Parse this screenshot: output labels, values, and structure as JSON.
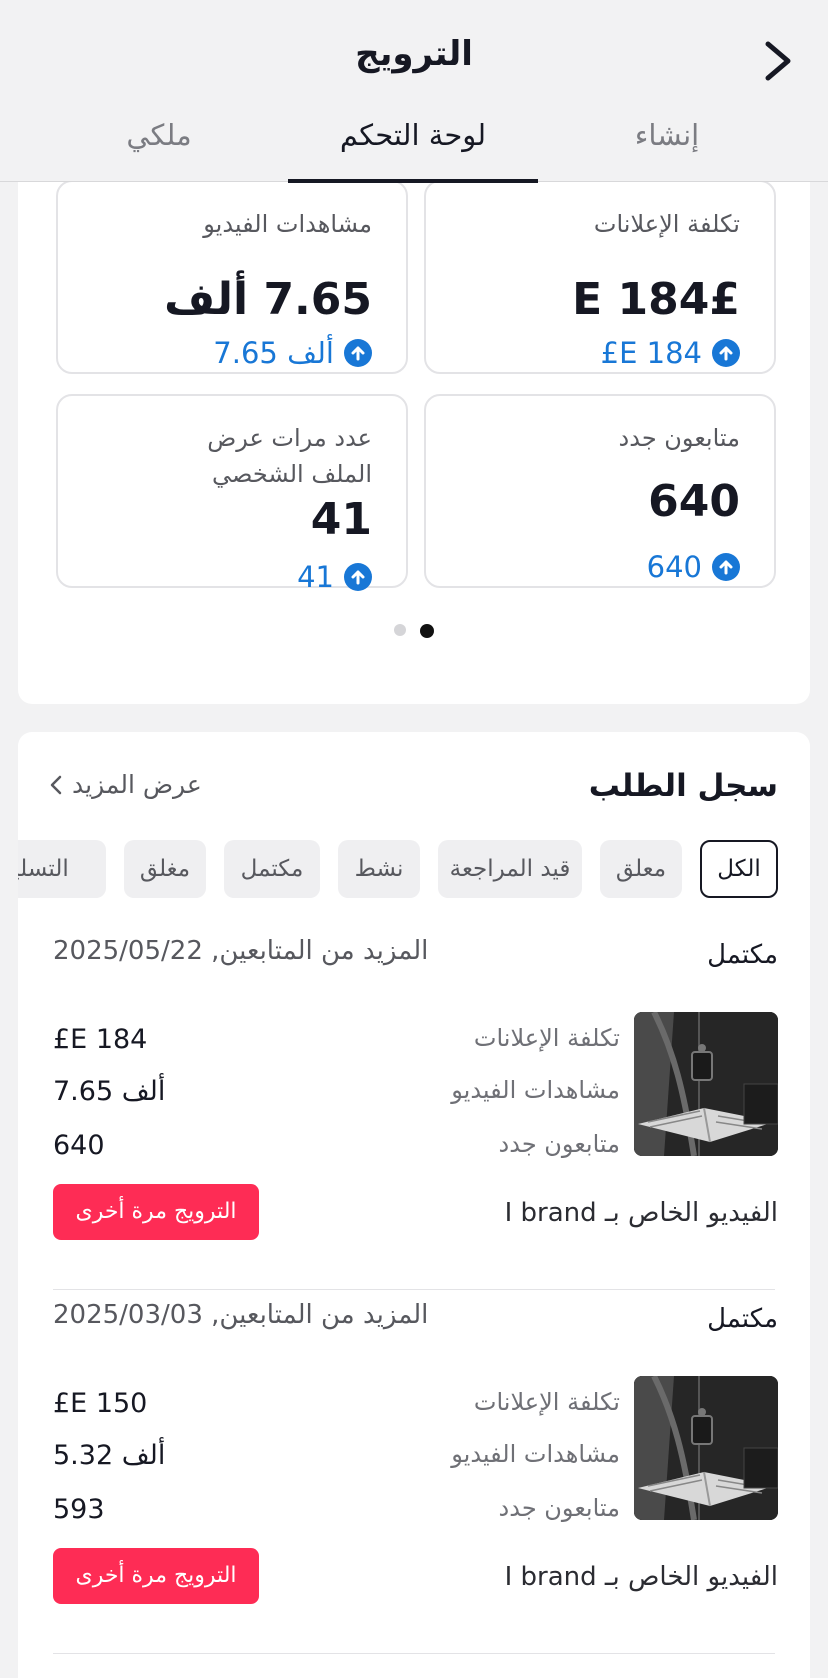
{
  "header": {
    "title": "الترويج",
    "tabs": [
      {
        "label": "إنشاء"
      },
      {
        "label": "لوحة التحكم"
      },
      {
        "label": "ملكي"
      }
    ]
  },
  "stats": [
    {
      "label": "تكلفة الإعلانات",
      "value": "£E 184",
      "change": "£E 184"
    },
    {
      "label": "مشاهدات الفيديو",
      "value": "7.65 ألف",
      "change": "7.65 ألف"
    },
    {
      "label": "متابعون جدد",
      "value": "640",
      "change": "640"
    },
    {
      "label": "عدد مرات عرض الملف الشخصي",
      "value": "41",
      "change": "41"
    }
  ],
  "pager": {
    "count": 2,
    "active": 2
  },
  "history": {
    "title": "سجل الطلب",
    "more_label": "عرض المزيد",
    "filters": [
      "الكل",
      "معلق",
      "قيد المراجعة",
      "نشط",
      "مكتمل",
      "مغلق",
      "التسليم"
    ],
    "selected_filter": "الكل",
    "orders": [
      {
        "status": "مكتمل",
        "goal_date": "المزيد من المتابعين, 2025/05/22",
        "metrics": [
          {
            "label": "تكلفة الإعلانات",
            "value": "£E 184"
          },
          {
            "label": "مشاهدات الفيديو",
            "value": "7.65 ألف"
          },
          {
            "label": "متابعون جدد",
            "value": "640"
          }
        ],
        "video_title": "الفيديو الخاص بـ I brand",
        "button": "الترويج مرة أخرى"
      },
      {
        "status": "مكتمل",
        "goal_date": "المزيد من المتابعين, 2025/03/03",
        "metrics": [
          {
            "label": "تكلفة الإعلانات",
            "value": "£E 150"
          },
          {
            "label": "مشاهدات الفيديو",
            "value": "5.32 ألف"
          },
          {
            "label": "متابعون جدد",
            "value": "593"
          }
        ],
        "video_title": "الفيديو الخاص بـ I brand",
        "button": "الترويج مرة أخرى"
      }
    ]
  },
  "colors": {
    "accent": "#fe2c55",
    "link": "#1877d6",
    "text": "#161823"
  }
}
